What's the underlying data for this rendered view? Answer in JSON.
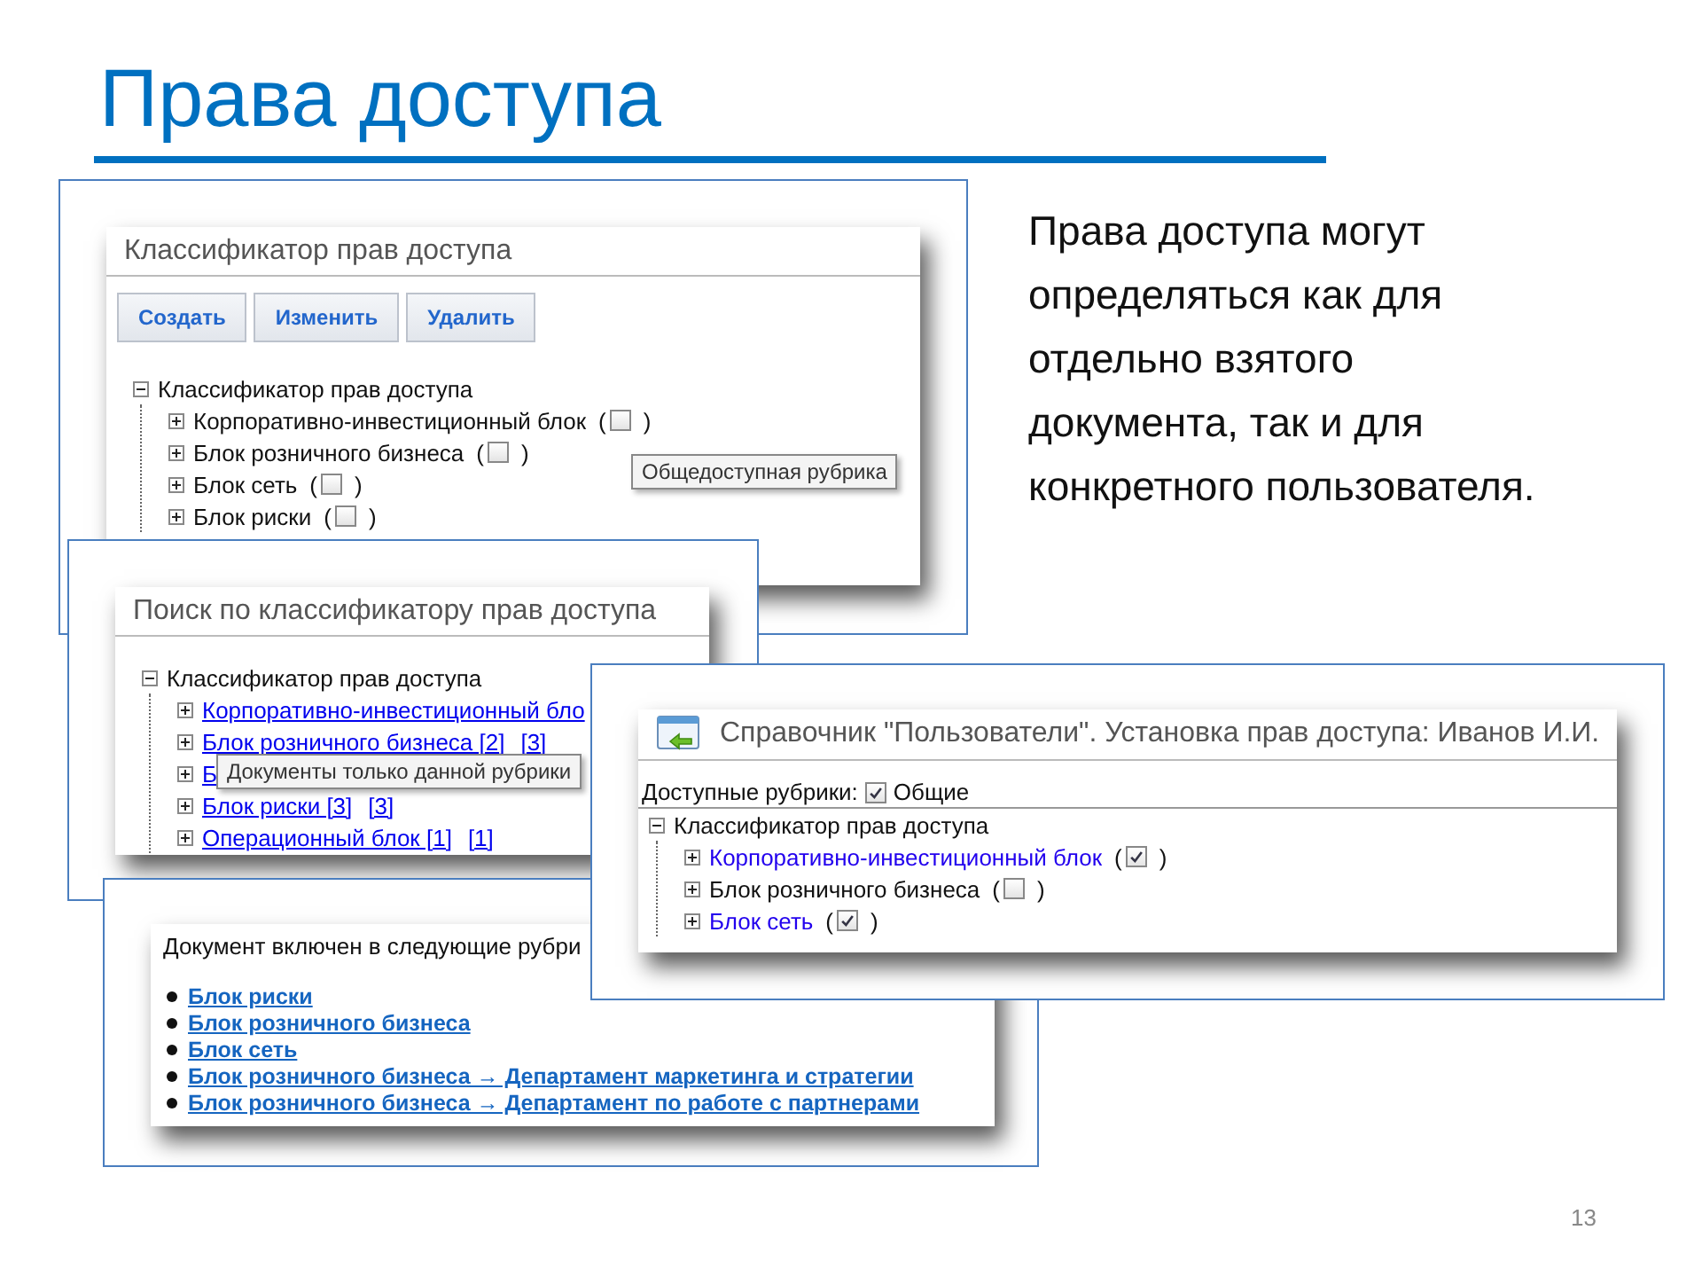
{
  "slide": {
    "title": "Права доступа",
    "text": "Права доступа могут определяться как для отдельно взятого документа, так и для конкретного пользователя.",
    "page_number": "13"
  },
  "classifier_window": {
    "title": "Классификатор прав доступа",
    "buttons": [
      "Создать",
      "Изменить",
      "Удалить"
    ],
    "tooltip": "Общедоступная рубрика",
    "tree": {
      "label": "Классификатор прав доступа",
      "expanded": true,
      "children": [
        {
          "label": "Корпоративно-инвестиционный блок",
          "open": "(",
          "close": ")",
          "expanded": false,
          "checked": false
        },
        {
          "label": "Блок розничного бизнеса",
          "open": "(",
          "close": ")",
          "expanded": false,
          "checked": false
        },
        {
          "label": "Блок сеть",
          "open": "(",
          "close": ")",
          "expanded": false,
          "checked": false
        },
        {
          "label": "Блок риски",
          "open": "(",
          "close": ")",
          "expanded": false,
          "checked": false
        }
      ]
    }
  },
  "search_window": {
    "title": "Поиск по классификатору прав доступа",
    "tree": {
      "label": "Классификатор прав доступа",
      "expanded": true,
      "children": [
        {
          "label": "Корпоративно-инвестиционный бло",
          "expanded": false
        },
        {
          "label": "Блок розничного бизнеса [2]",
          "count": "[3]",
          "expanded": false
        },
        {
          "label": "Б",
          "expanded": false,
          "tooltip": "Документы только данной рубрики"
        },
        {
          "label": "Блок риски [3]",
          "count": "[3]",
          "expanded": false
        },
        {
          "label": "Операционный блок [1]",
          "count": "[1]",
          "expanded": false
        }
      ]
    }
  },
  "document_window": {
    "intro": "Документ включен в следующие рубри",
    "links": [
      "Блок риски",
      "Блок розничного бизнеса",
      "Блок сеть",
      "Блок розничного бизнеса → Департамент маркетинга и стратегии",
      "Блок розничного бизнеса → Департамент по работе с партнерами"
    ]
  },
  "users_window": {
    "title": "Справочник \"Пользователи\". Установка прав доступа: Иванов И.И.",
    "available_label": "Доступные рубрики:",
    "common": {
      "label": "Общие",
      "checked": true
    },
    "tree": {
      "label": "Классификатор прав доступа",
      "expanded": true,
      "children": [
        {
          "label": "Корпоративно-инвестиционный блок",
          "open": "(",
          "close": ")",
          "expanded": false,
          "checked": true
        },
        {
          "label": "Блок розничного бизнеса",
          "open": "(",
          "close": ")",
          "expanded": false,
          "checked": false
        },
        {
          "label": "Блок сеть",
          "open": "(",
          "close": ")",
          "expanded": false,
          "checked": true
        }
      ]
    }
  }
}
